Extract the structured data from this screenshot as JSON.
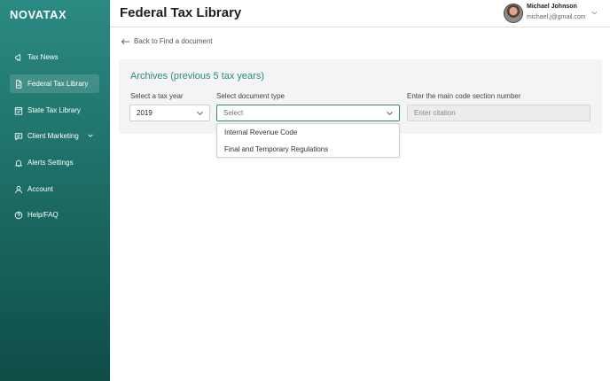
{
  "app": {
    "logo": "NOVATAX"
  },
  "sidebar": {
    "items": [
      {
        "label": "Tax News",
        "icon": "megaphone-icon",
        "active": false
      },
      {
        "label": "Federal Tax Library",
        "icon": "document-icon",
        "active": true
      },
      {
        "label": "State Tax Library",
        "icon": "calendar-icon",
        "active": false
      },
      {
        "label": "Client Marketing",
        "icon": "chat-icon",
        "active": false,
        "has_submenu": true
      },
      {
        "label": "Alerts Settings",
        "icon": "bell-icon",
        "active": false
      },
      {
        "label": "Account",
        "icon": "user-icon",
        "active": false
      },
      {
        "label": "Help/FAQ",
        "icon": "help-icon",
        "active": false
      }
    ]
  },
  "header": {
    "title": "Federal Tax Library",
    "user": {
      "name": "Michael Johnson",
      "email": "michael.j@gmail.com"
    }
  },
  "back_link": {
    "label": "Back to Find a document"
  },
  "panel": {
    "title": "Archives (previous 5 tax years)",
    "tax_year": {
      "label": "Select a tax year",
      "value": "2019"
    },
    "document_type": {
      "label": "Select document type",
      "placeholder": "Select",
      "options": [
        "Internal Revenue Code",
        "Final and Temporary Regulations"
      ]
    },
    "citation": {
      "label": "Enter the main code section number",
      "placeholder": "Enter citation"
    }
  },
  "colors": {
    "accent": "#2a8a83",
    "sidebar_top": "#2b8a82",
    "sidebar_bottom": "#0f4d47"
  }
}
